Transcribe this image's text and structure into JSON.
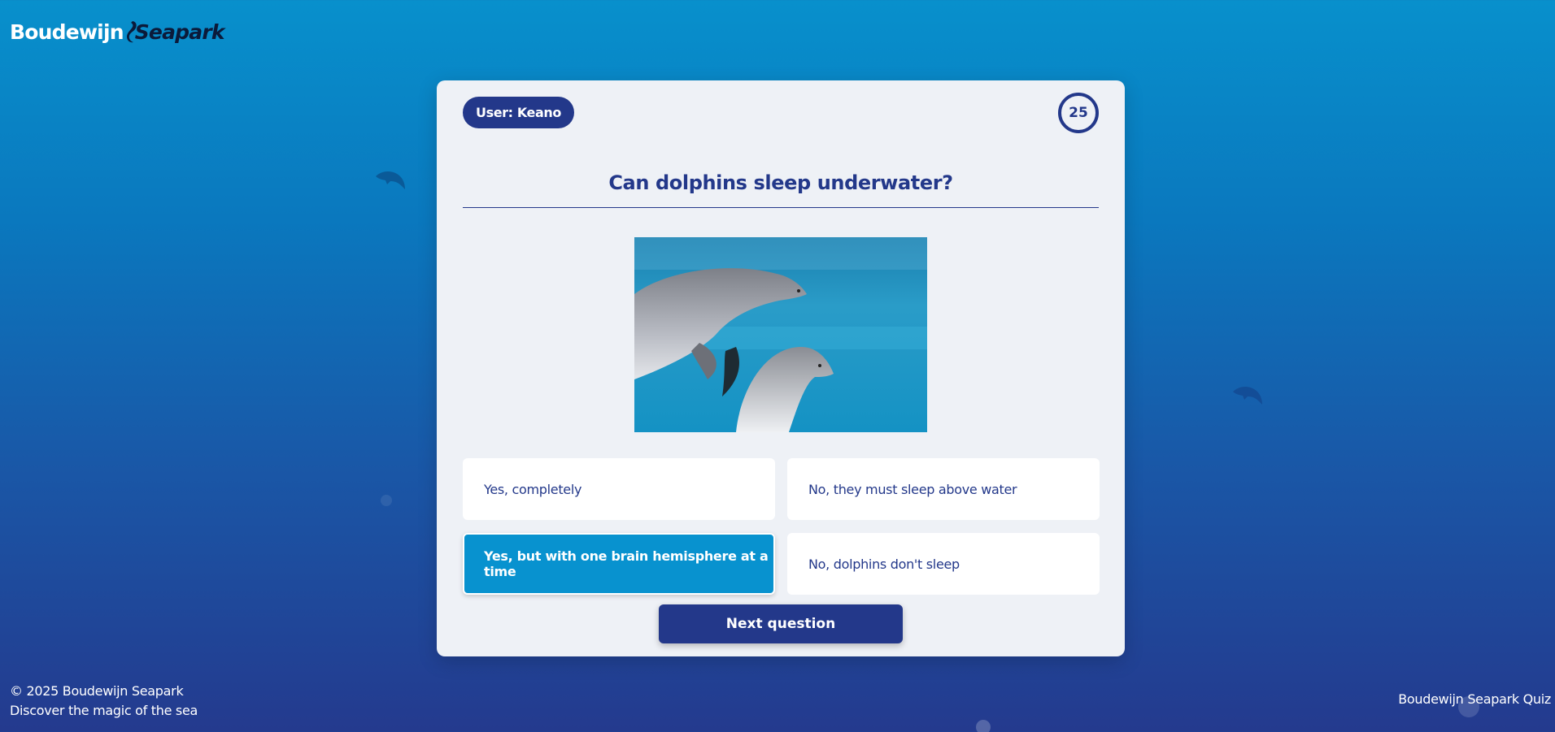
{
  "brand": {
    "logo_part1": "Boudewijn",
    "logo_part2": "Seapark"
  },
  "quiz": {
    "user_label": "User: Keano",
    "timer": "25",
    "question": "Can dolphins sleep underwater?",
    "answers": [
      {
        "label": "Yes, completely",
        "selected": false
      },
      {
        "label": "No, they must sleep above water",
        "selected": false
      },
      {
        "label": "Yes, but with one brain hemisphere at a time",
        "selected": true
      },
      {
        "label": "No, dolphins don't sleep",
        "selected": false
      }
    ],
    "next_label": "Next question"
  },
  "footer": {
    "copyright": "© 2025 Boudewijn Seapark",
    "tagline": "Discover the magic of the sea",
    "right_text": "Boudewijn Seapark Quiz"
  },
  "colors": {
    "primary": "#23388a",
    "selected": "#0892cf",
    "card_bg": "#eef1f6"
  }
}
